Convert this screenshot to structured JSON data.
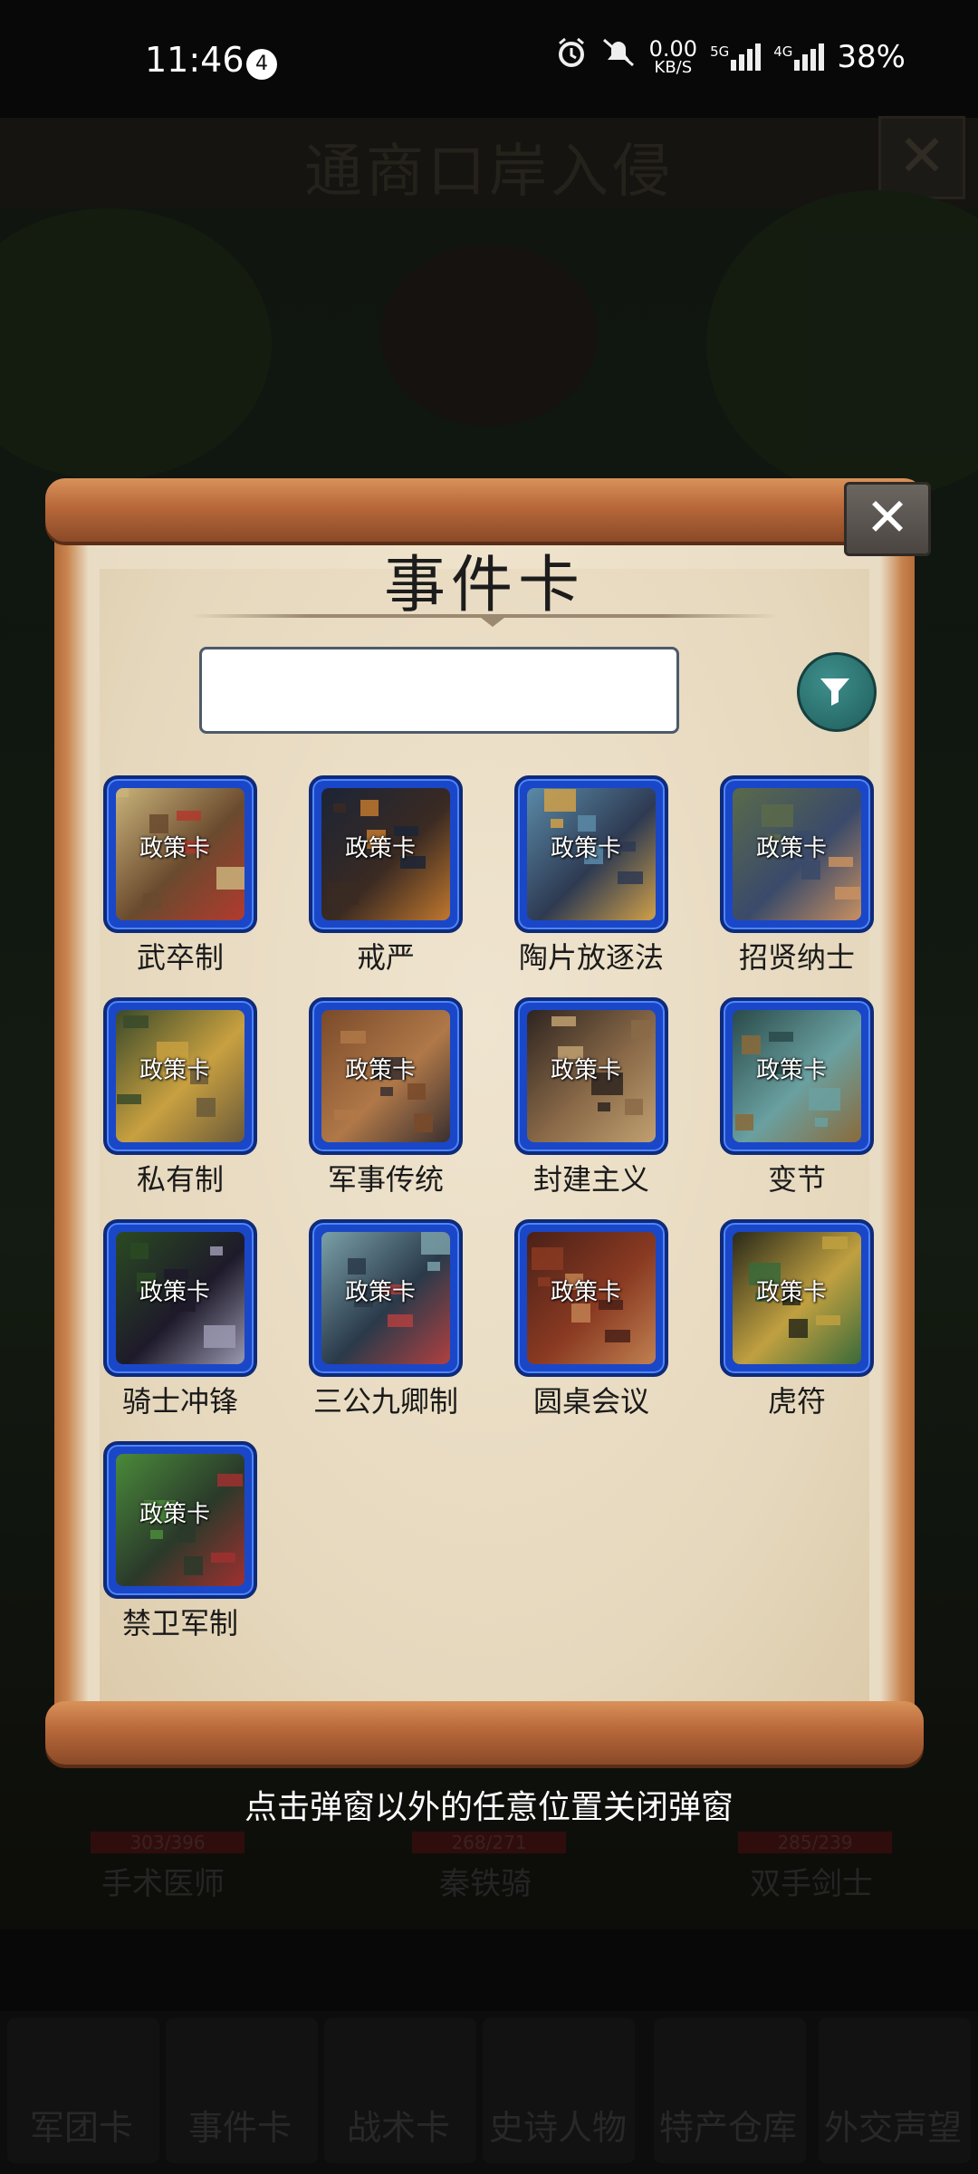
{
  "status_bar": {
    "time": "11:46",
    "notification_count": "4",
    "net_speed_value": "0.00",
    "net_speed_unit": "KB/S",
    "signal_1": "5G",
    "signal_2": "4G",
    "battery": "38%"
  },
  "background": {
    "page_title": "通商口岸入侵",
    "units": [
      {
        "hp": "303/396",
        "name": "手术医师"
      },
      {
        "hp": "268/271",
        "name": "秦铁骑"
      },
      {
        "hp": "285/239",
        "name": "双手剑士"
      }
    ],
    "nav_tabs": [
      "军团卡",
      "事件卡",
      "战术卡",
      "史诗人物",
      "特产仓库",
      "外交声望"
    ]
  },
  "dialog": {
    "title": "事件卡",
    "search_value": "",
    "search_placeholder": "",
    "card_tag": "政策卡",
    "cards": [
      {
        "name": "武卒制",
        "palette": [
          "#c9b37a",
          "#6a4a2e",
          "#b23a2e"
        ]
      },
      {
        "name": "戒严",
        "palette": [
          "#1c2436",
          "#3a2a22",
          "#c0772e"
        ]
      },
      {
        "name": "陶片放逐法",
        "palette": [
          "#5a8aa8",
          "#2e3a52",
          "#d0a048"
        ]
      },
      {
        "name": "招贤纳士",
        "palette": [
          "#5a6a4a",
          "#3a4a6a",
          "#c89060"
        ]
      },
      {
        "name": "私有制",
        "palette": [
          "#3a4a2a",
          "#c8a040",
          "#6a5a3a"
        ]
      },
      {
        "name": "军事传统",
        "palette": [
          "#7a4a2a",
          "#b07848",
          "#3a3030"
        ]
      },
      {
        "name": "封建主义",
        "palette": [
          "#2e2420",
          "#8a6a48",
          "#c0a070"
        ]
      },
      {
        "name": "变节",
        "palette": [
          "#2a4a4a",
          "#6aa0a0",
          "#8a6a3a"
        ]
      },
      {
        "name": "骑士冲锋",
        "palette": [
          "#2a4a22",
          "#1e1a2a",
          "#9a98b0"
        ]
      },
      {
        "name": "三公九卿制",
        "palette": [
          "#7aa0a8",
          "#2a3a4a",
          "#b04040"
        ]
      },
      {
        "name": "圆桌会议",
        "palette": [
          "#4a2018",
          "#8a3a22",
          "#c08050"
        ]
      },
      {
        "name": "虎符",
        "palette": [
          "#2a2a1a",
          "#c0a040",
          "#3a6a3a"
        ]
      },
      {
        "name": "禁卫军制",
        "palette": [
          "#4a8a3a",
          "#2a3a2a",
          "#a03030"
        ]
      }
    ],
    "close_hint": "点击弹窗以外的任意位置关闭弹窗"
  },
  "icons": {
    "close": "close-icon",
    "filter": "filter-icon",
    "alarm": "alarm-icon",
    "mute": "mute-icon"
  }
}
